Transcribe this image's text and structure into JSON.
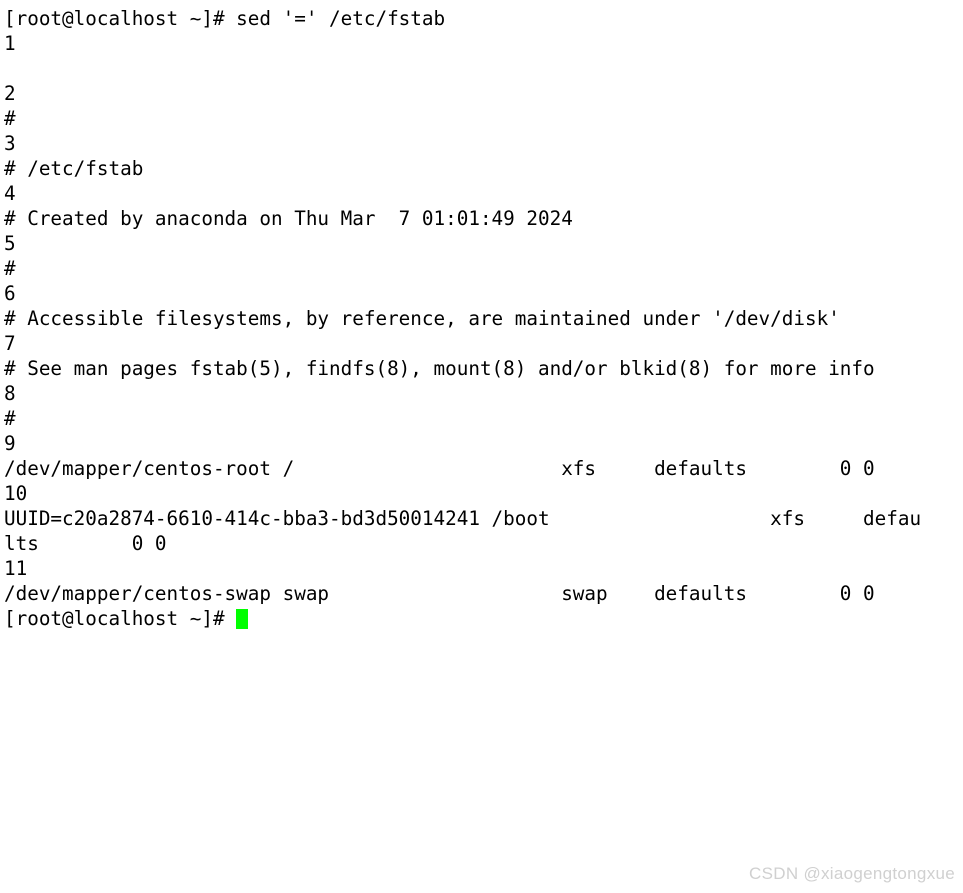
{
  "terminal": {
    "background_color": "#ffffff",
    "foreground_color": "#000000",
    "cursor_color": "#00ff00",
    "prompt": "[root@localhost ~]#",
    "command": "sed '=' /etc/fstab",
    "lines": [
      "[root@localhost ~]# sed '=' /etc/fstab",
      "1",
      "",
      "2",
      "#",
      "3",
      "# /etc/fstab",
      "4",
      "# Created by anaconda on Thu Mar  7 01:01:49 2024",
      "5",
      "#",
      "6",
      "# Accessible filesystems, by reference, are maintained under '/dev/disk'",
      "7",
      "# See man pages fstab(5), findfs(8), mount(8) and/or blkid(8) for more info",
      "8",
      "#",
      "9",
      "/dev/mapper/centos-root /                       xfs     defaults        0 0",
      "10",
      "UUID=c20a2874-6610-414c-bba3-bd3d50014241 /boot                   xfs     defau",
      "lts        0 0",
      "11",
      "/dev/mapper/centos-swap swap                    swap    defaults        0 0"
    ],
    "final_prompt": "[root@localhost ~]# "
  },
  "watermark": {
    "text": "CSDN @xiaogengtongxue",
    "color": "#d0d0d0"
  }
}
